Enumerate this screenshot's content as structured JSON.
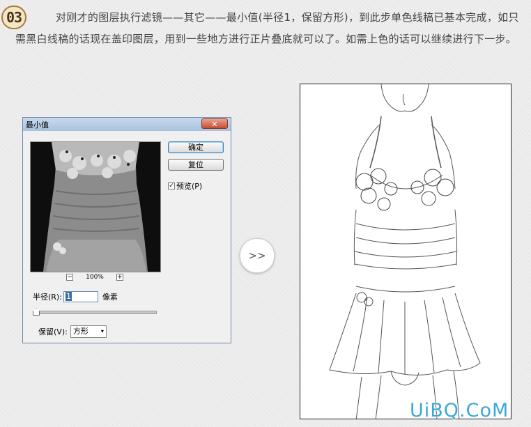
{
  "step": {
    "number": "03",
    "text": "对刚才的图层执行滤镜——其它——最小值(半径1，保留方形)，到此步单色线稿已基本完成，如只需黑白线稿的话现在盖印图层，用到一些地方进行正片叠底就可以了。如需上色的话可以继续进行下一步。"
  },
  "dialog": {
    "title": "最小值",
    "close_label": "✕",
    "ok_label": "确定",
    "reset_label": "复位",
    "preview_label": "预览(P)",
    "preview_checked": "✓",
    "zoom_out": "−",
    "zoom_level": "100%",
    "zoom_in": "+",
    "radius_label": "半径(R):",
    "radius_value": "1",
    "radius_unit": "像素",
    "slider_value": 1,
    "keep_label": "保留(V):",
    "keep_value": "方形",
    "keep_caret": "▾"
  },
  "arrow": {
    "label": ">>"
  },
  "watermark": {
    "text": "UiBQ.CoM",
    "color": "#3aa8d8"
  },
  "colors": {
    "badge_border": "#a87a34",
    "dialog_border": "#6f8aa8",
    "close_button": "#c84d33"
  }
}
